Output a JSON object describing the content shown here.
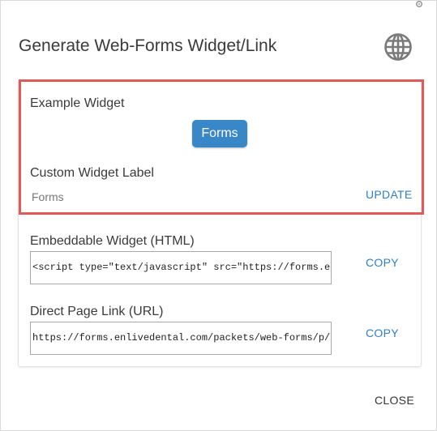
{
  "dialog": {
    "title": "Generate Web-Forms Widget/Link",
    "close_label": "CLOSE"
  },
  "example": {
    "heading": "Example Widget",
    "widget_button_label": "Forms",
    "widget_color": "#3a87c8"
  },
  "custom_label": {
    "heading": "Custom Widget Label",
    "value": "Forms",
    "update_label": "UPDATE"
  },
  "embed": {
    "heading": "Embeddable Widget (HTML)",
    "code": "<script type=\"text/javascript\" src=\"https://forms.e",
    "copy_label": "COPY"
  },
  "direct_link": {
    "heading": "Direct Page Link (URL)",
    "url": "https://forms.enlivedental.com/packets/web-forms/p/",
    "copy_label": "COPY"
  },
  "icons": {
    "globe": "globe-icon",
    "corner": "settings-icon"
  },
  "colors": {
    "accent": "#2f7fc1",
    "highlight_border": "#e05a5a"
  }
}
